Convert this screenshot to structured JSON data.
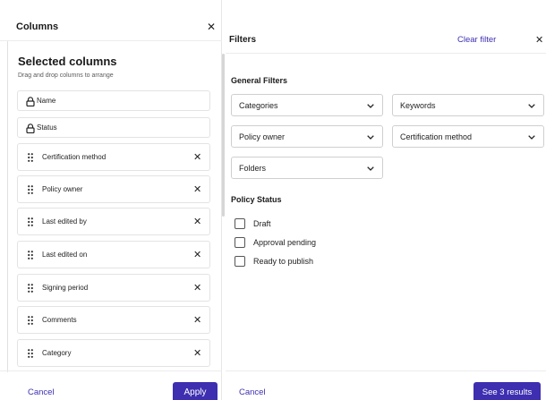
{
  "columns_panel": {
    "title": "Columns",
    "close_icon": "close-icon",
    "selected_title": "Selected columns",
    "hint": "Drag and drop columns to arrange",
    "locked_items": [
      {
        "label": "Name",
        "icon": "lock-icon"
      },
      {
        "label": "Status",
        "icon": "lock-icon"
      }
    ],
    "items": [
      {
        "label": "Certification method",
        "icon": "grip-icon"
      },
      {
        "label": "Policy owner",
        "icon": "grip-icon"
      },
      {
        "label": "Last edited by",
        "icon": "grip-icon"
      },
      {
        "label": "Last edited on",
        "icon": "grip-icon"
      },
      {
        "label": "Signing period",
        "icon": "grip-icon"
      },
      {
        "label": "Comments",
        "icon": "grip-icon"
      },
      {
        "label": "Category",
        "icon": "grip-icon"
      }
    ],
    "cancel_label": "Cancel",
    "apply_label": "Apply"
  },
  "filters_panel": {
    "title": "Filters",
    "clear_label": "Clear filter",
    "general_heading": "General Filters",
    "selects": {
      "categories": "Categories",
      "keywords": "Keywords",
      "policy_owner": "Policy owner",
      "certification_method": "Certification method",
      "folders": "Folders"
    },
    "status_heading": "Policy Status",
    "statuses": [
      {
        "label": "Draft",
        "checked": false
      },
      {
        "label": "Approval pending",
        "checked": false
      },
      {
        "label": "Ready to publish",
        "checked": false
      }
    ],
    "cancel_label": "Cancel",
    "results_label": "See 3 results"
  },
  "colors": {
    "accent": "#3d2fb0",
    "border": "#e3e3e3",
    "text": "#1f1f1f"
  }
}
